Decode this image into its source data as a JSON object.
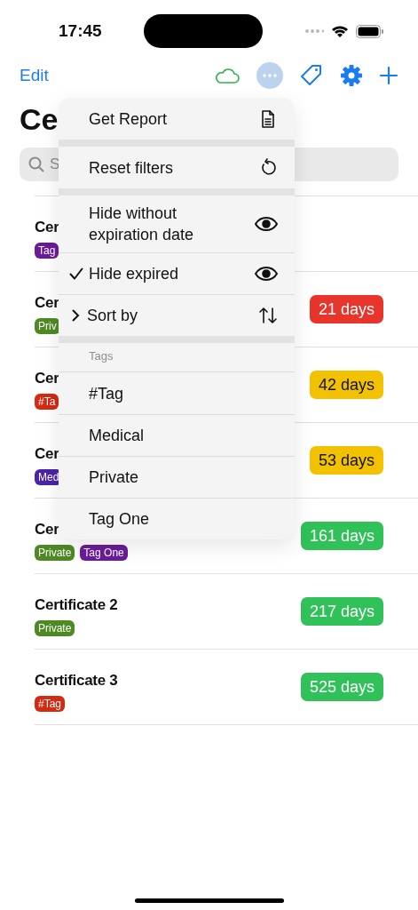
{
  "status_bar": {
    "time": "17:45"
  },
  "nav": {
    "edit": "Edit",
    "title": "Ce",
    "search_placeholder": "S"
  },
  "menu": {
    "sections": [
      {
        "items": [
          {
            "kind": "report",
            "label": "Get Report",
            "checked": false
          }
        ]
      },
      {
        "items": [
          {
            "kind": "reset",
            "label": "Reset filters",
            "checked": false
          }
        ]
      },
      {
        "items": [
          {
            "kind": "toggle",
            "label": "Hide without expiration date",
            "checked": false
          },
          {
            "kind": "toggle",
            "label": "Hide expired",
            "checked": true
          },
          {
            "kind": "submenu",
            "label": "Sort by",
            "checked": false
          }
        ]
      },
      {
        "header": "Tags",
        "items": [
          {
            "kind": "tag",
            "label": "#Tag",
            "checked": false
          },
          {
            "kind": "tag",
            "label": "Medical",
            "checked": false
          },
          {
            "kind": "tag",
            "label": "Private",
            "checked": false
          },
          {
            "kind": "tag",
            "label": "Tag One",
            "checked": false
          }
        ]
      }
    ]
  },
  "rows": [
    {
      "title": "Cer",
      "tags": [
        {
          "label": "Tag",
          "color": "#6a1b9a"
        }
      ]
    },
    {
      "title": "Cer",
      "tags": [
        {
          "label": "Priv",
          "color": "#4e8a23"
        }
      ],
      "badge": {
        "label": "21 days",
        "color": "#e8352b"
      }
    },
    {
      "title": "Cer",
      "tags": [
        {
          "label": "#Ta",
          "color": "#d42a12"
        }
      ],
      "badge": {
        "label": "42 days",
        "color": "#f2c100"
      }
    },
    {
      "title": "Cer",
      "tags": [
        {
          "label": "Med",
          "color": "#4b24a8"
        }
      ],
      "badge": {
        "label": "53 days",
        "color": "#f2c100"
      }
    },
    {
      "title": "Cer",
      "tags": [
        {
          "label": "Private",
          "color": "#4e8a23"
        },
        {
          "label": "Tag One",
          "color": "#6a1b9a"
        }
      ],
      "badge": {
        "label": "161 days",
        "color": "#30c158"
      }
    },
    {
      "title": "Certificate 2",
      "tags": [
        {
          "label": "Private",
          "color": "#4e8a23"
        }
      ],
      "badge": {
        "label": "217 days",
        "color": "#30c158"
      }
    },
    {
      "title": "Certificate 3",
      "tags": [
        {
          "label": "#Tag",
          "color": "#d42a12"
        }
      ],
      "badge": {
        "label": "525 days",
        "color": "#30c158"
      }
    }
  ]
}
